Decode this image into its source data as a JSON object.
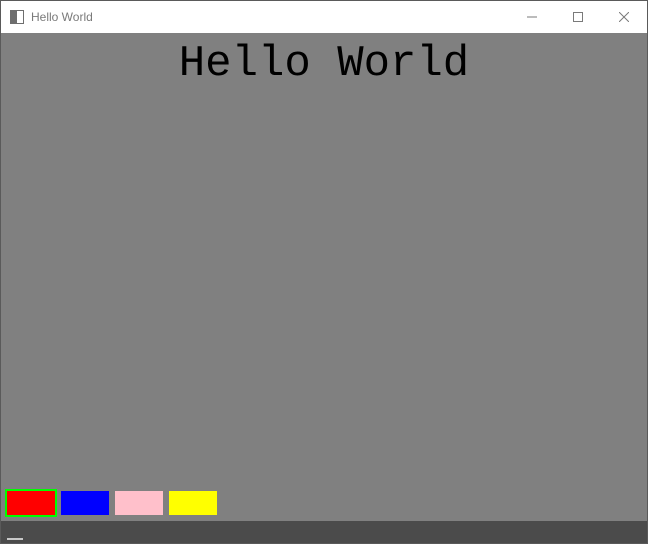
{
  "window": {
    "title": "Hello World"
  },
  "main": {
    "heading": "Hello World"
  },
  "palette": {
    "colors": [
      {
        "name": "red",
        "hex": "#ff0000",
        "selected": true
      },
      {
        "name": "blue",
        "hex": "#0000ff",
        "selected": false
      },
      {
        "name": "pink",
        "hex": "#ffc0cb",
        "selected": false
      },
      {
        "name": "yellow",
        "hex": "#ffff00",
        "selected": false
      }
    ]
  }
}
